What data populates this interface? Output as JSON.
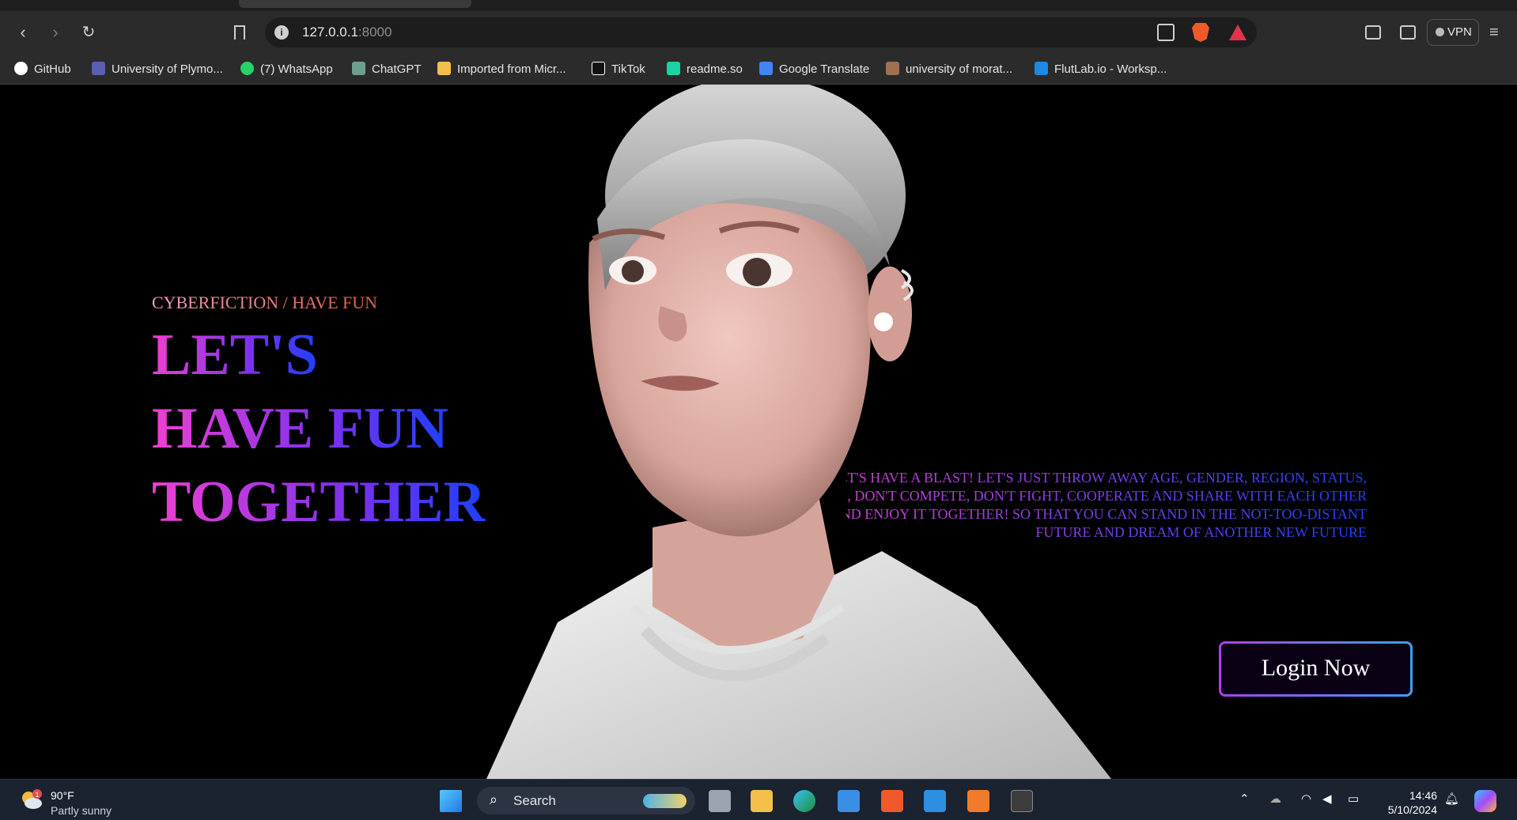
{
  "browser": {
    "url_host": "127.0.0.1",
    "url_port": ":8000",
    "vpn_label": "VPN",
    "bookmarks": [
      {
        "label": "GitHub",
        "icon": "github-icon"
      },
      {
        "label": "University of Plymo...",
        "icon": "university-crest-icon"
      },
      {
        "label": "(7) WhatsApp",
        "icon": "whatsapp-icon"
      },
      {
        "label": "ChatGPT",
        "icon": "chatgpt-icon"
      },
      {
        "label": "Imported from Micr...",
        "icon": "folder-icon"
      },
      {
        "label": "TikTok",
        "icon": "tiktok-icon"
      },
      {
        "label": "readme.so",
        "icon": "readme-icon"
      },
      {
        "label": "Google Translate",
        "icon": "translate-icon"
      },
      {
        "label": "university of morat...",
        "icon": "moratuwa-icon"
      },
      {
        "label": "FlutLab.io - Worksp...",
        "icon": "flutlab-icon"
      }
    ]
  },
  "hero": {
    "eyebrow": "CYBERFICTION / HAVE FUN",
    "headline_lines": [
      "LET'S",
      "HAVE FUN",
      "TOGETHER"
    ],
    "description": "LET'S HAVE A BLAST! LET'S JUST THROW AWAY AGE, GENDER, REGION, STATUS, ETC., DON'T COMPETE, DON'T FIGHT, COOPERATE AND SHARE WITH EACH OTHER AND ENJOY IT TOGETHER! SO THAT YOU CAN STAND IN THE NOT-TOO-DISTANT FUTURE AND DREAM OF ANOTHER NEW FUTURE",
    "login_label": "Login Now",
    "portrait_image": "3d-character-portrait"
  },
  "taskbar": {
    "weather_temp": "90°F",
    "weather_desc": "Partly sunny",
    "weather_badge": "1",
    "search_label": "Search",
    "time": "14:46",
    "date": "5/10/2024"
  },
  "colors": {
    "headline_gradient": [
      "#f040d0",
      "#7a30f0",
      "#1e40ff"
    ],
    "eyebrow_gradient": [
      "#f0a0c0",
      "#e06040"
    ],
    "login_border_gradient": [
      "#b03cf0",
      "#3aa0ff"
    ]
  }
}
